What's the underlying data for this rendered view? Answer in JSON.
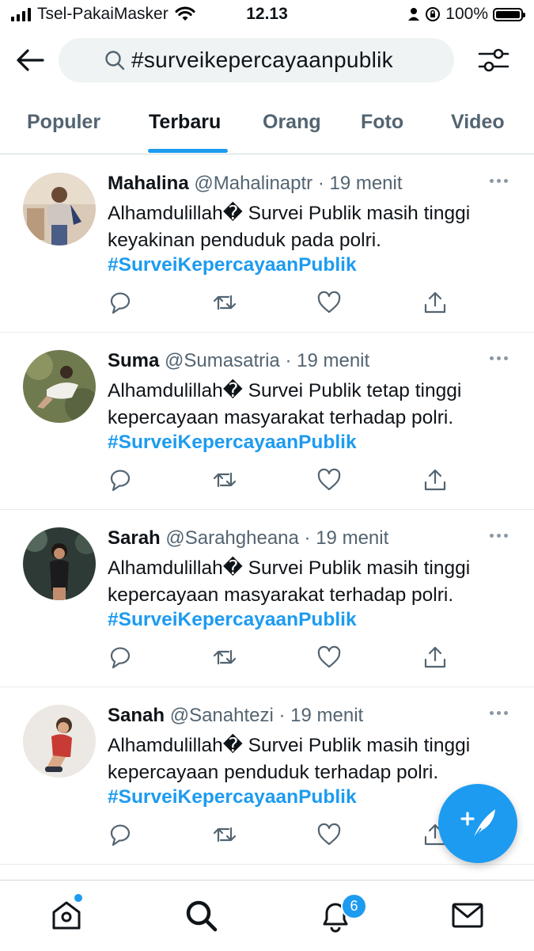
{
  "status_bar": {
    "carrier": "Tsel-PakaiMasker",
    "time": "12.13",
    "battery": "100%"
  },
  "search": {
    "query": "#surveikepercayaanpublik"
  },
  "tabs": [
    {
      "label": "Populer",
      "active": false
    },
    {
      "label": "Terbaru",
      "active": true
    },
    {
      "label": "Orang",
      "active": false
    },
    {
      "label": "Foto",
      "active": false
    },
    {
      "label": "Video",
      "active": false
    }
  ],
  "tweets": [
    {
      "name": "Mahalina",
      "handle": "@Mahalinaptr",
      "time": "· 19 menit",
      "text": "Alhamdulillah� Survei Publik masih tinggi keyakinan penduduk pada polri.",
      "hashtag": "#SurveiKepercayaanPublik"
    },
    {
      "name": "Suma",
      "handle": "@Sumasatria",
      "time": "· 19 menit",
      "text": "Alhamdulillah� Survei Publik tetap tinggi kepercayaan masyarakat terhadap polri.",
      "hashtag": "#SurveiKepercayaanPublik"
    },
    {
      "name": "Sarah",
      "handle": "@Sarahgheana",
      "time": "· 19 menit",
      "text": "Alhamdulillah� Survei Publik masih tinggi kepercayaan masyarakat terhadap polri.",
      "hashtag": "#SurveiKepercayaanPublik"
    },
    {
      "name": "Sanah",
      "handle": "@Sanahtezi",
      "time": "· 19 menit",
      "text": "Alhamdulillah� Survei Publik masih tinggi kepercayaan penduduk terhadap polri.",
      "hashtag": "#SurveiKepercayaanPublik"
    }
  ],
  "bottom_nav": {
    "notifications_count": "6"
  },
  "icons": {
    "back": "back-arrow-icon",
    "search": "search-icon",
    "filters": "filter-sliders-icon",
    "reply": "reply-icon",
    "retweet": "retweet-icon",
    "like": "like-icon",
    "share": "share-icon",
    "compose": "compose-tweet-icon",
    "home": "home-icon",
    "explore": "explore-search-icon",
    "notifications": "bell-icon",
    "messages": "mail-icon"
  },
  "colors": {
    "accent": "#1d9bf0",
    "text": "#0f1419",
    "secondary": "#536471"
  }
}
